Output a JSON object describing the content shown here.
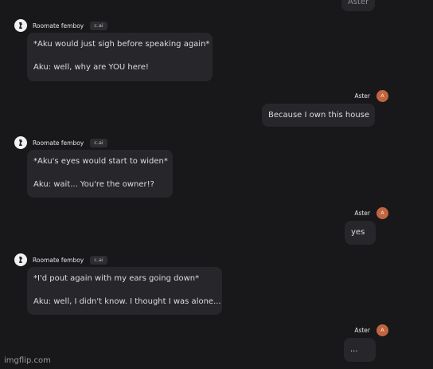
{
  "messages": [
    {
      "role": "user",
      "name": "Aster",
      "avatar_letter": "A",
      "lines": [
        "Aster"
      ]
    },
    {
      "role": "bot",
      "name": "Roomate femboy",
      "tag": "c.ai",
      "lines": [
        "*Aku would just sigh before speaking again*",
        "Aku: well, why are YOU here!"
      ]
    },
    {
      "role": "user",
      "name": "Aster",
      "avatar_letter": "A",
      "lines": [
        "Because I own this house"
      ]
    },
    {
      "role": "bot",
      "name": "Roomate femboy",
      "tag": "c.ai",
      "lines": [
        "*Aku's eyes would start to widen*",
        "Aku: wait... You're the owner!?"
      ]
    },
    {
      "role": "user",
      "name": "Aster",
      "avatar_letter": "A",
      "lines": [
        "yes"
      ]
    },
    {
      "role": "bot",
      "name": "Roomate femboy",
      "tag": "c.ai",
      "lines": [
        "*I'd pout again with my ears going down*",
        "Aku: well, I didn't know. I thought I was alone..."
      ]
    },
    {
      "role": "user",
      "name": "Aster",
      "avatar_letter": "A",
      "lines": [
        "..."
      ]
    }
  ],
  "watermark": "imgflip.com",
  "colors": {
    "background": "#18181b",
    "bubble": "#26262b",
    "user_avatar": "#c0653f"
  }
}
